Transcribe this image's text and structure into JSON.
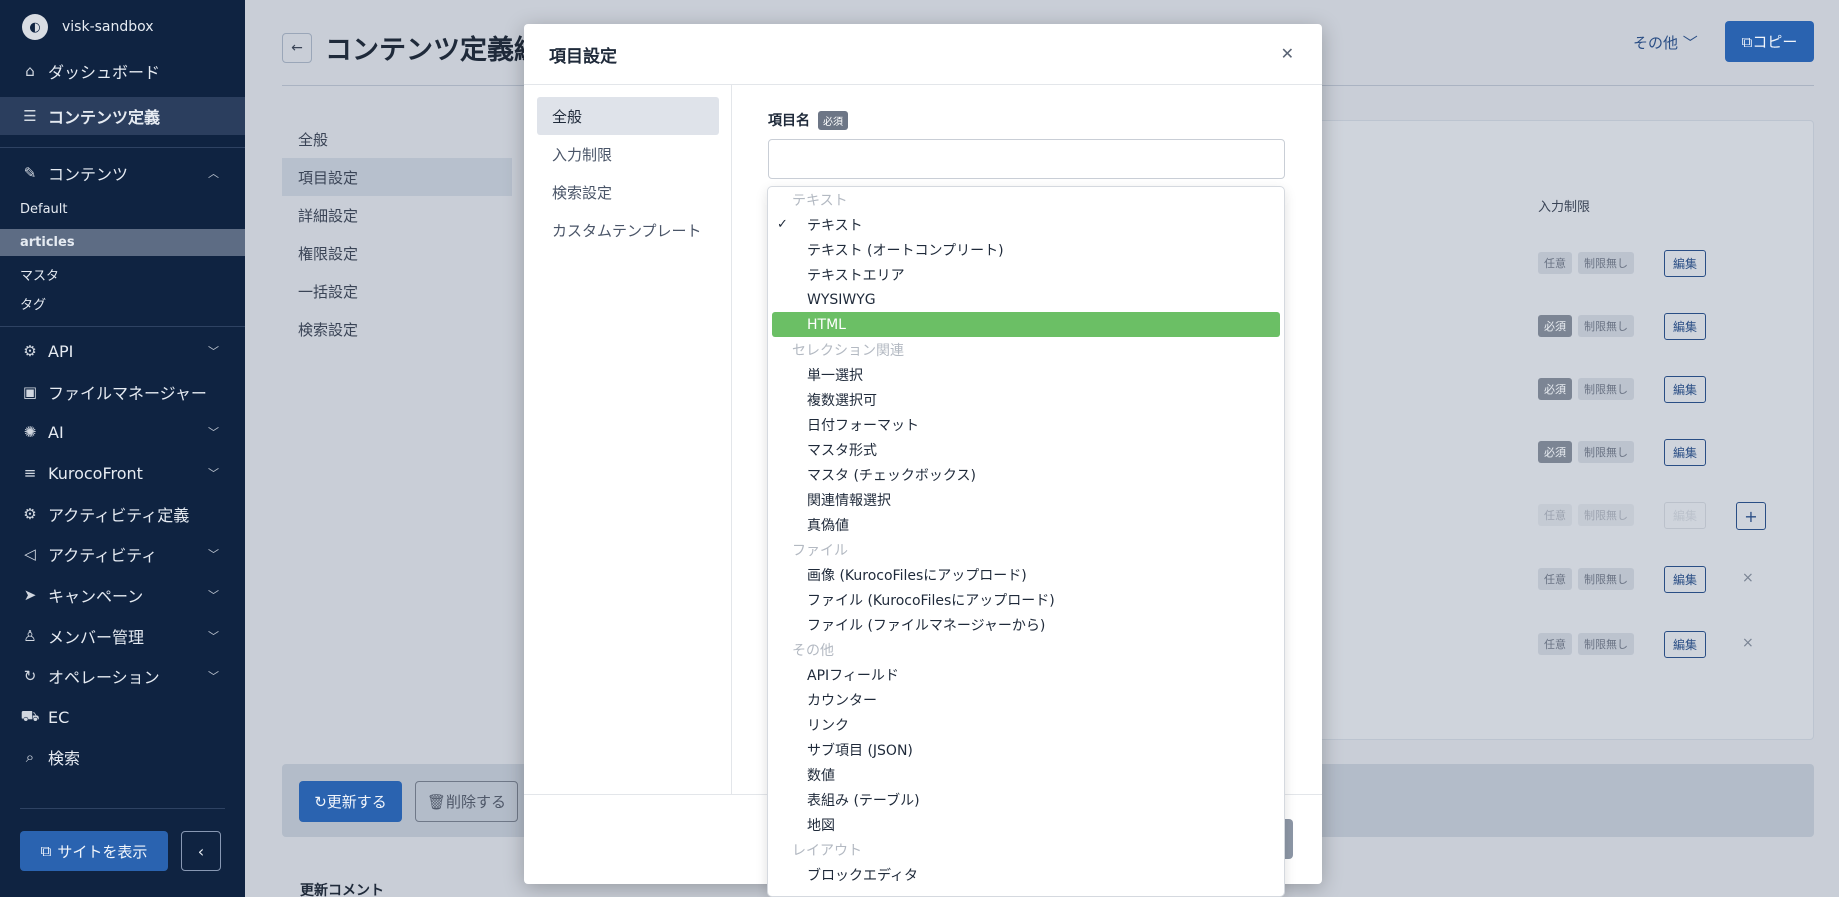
{
  "sidebar": {
    "site_name": "visk-sandbox",
    "items": [
      {
        "label": "ダッシュボード",
        "icon": "home-icon"
      },
      {
        "label": "コンテンツ定義",
        "icon": "database-icon"
      },
      {
        "label": "コンテンツ",
        "icon": "edit-icon"
      },
      {
        "label": "API",
        "icon": "gear-icon"
      },
      {
        "label": "ファイルマネージャー",
        "icon": "image-icon"
      },
      {
        "label": "AI",
        "icon": "ai-icon"
      },
      {
        "label": "KurocoFront",
        "icon": "server-icon"
      },
      {
        "label": "アクティビティ定義",
        "icon": "gear-icon"
      },
      {
        "label": "アクティビティ",
        "icon": "bullhorn-icon"
      },
      {
        "label": "キャンペーン",
        "icon": "send-icon"
      },
      {
        "label": "メンバー管理",
        "icon": "user-icon"
      },
      {
        "label": "オペレーション",
        "icon": "refresh-icon"
      },
      {
        "label": "EC",
        "icon": "cart-icon"
      },
      {
        "label": "検索",
        "icon": "search-icon"
      }
    ],
    "content_sub": [
      "Default",
      "articles",
      "マスタ",
      "タグ"
    ],
    "site_button": "サイトを表示",
    "collapse_icon": "chevron-left-icon"
  },
  "page": {
    "title": "コンテンツ定義編",
    "more_label": "その他",
    "copy_label": "コピー",
    "tabs": [
      "全般",
      "項目設定",
      "詳細設定",
      "権限設定",
      "一括設定",
      "検索設定"
    ],
    "column_header": "入力制限",
    "rows": [
      {
        "req": "任意",
        "limit": "制限無し",
        "edit": "編集"
      },
      {
        "req": "必須",
        "limit": "制限無し",
        "edit": "編集"
      },
      {
        "req": "必須",
        "limit": "制限無し",
        "edit": "編集"
      },
      {
        "req": "必須",
        "limit": "制限無し",
        "edit": "編集"
      },
      {
        "req": "任意",
        "limit": "制限無し",
        "edit": "編集"
      },
      {
        "req": "任意",
        "limit": "制限無し",
        "edit": "編集"
      },
      {
        "req": "任意",
        "limit": "制限無し",
        "edit": "編集"
      }
    ],
    "update_label": "更新する",
    "delete_label": "削除する",
    "comment_label": "更新コメント"
  },
  "modal": {
    "title": "項目設定",
    "nav": [
      "全般",
      "入力制限",
      "検索設定",
      "カスタムテンプレート"
    ],
    "field_label": "項目名",
    "required_badge": "必須",
    "name_value": ""
  },
  "dropdown": {
    "groups": [
      {
        "name": "テキスト",
        "options": [
          "テキスト",
          "テキスト (オートコンプリート)",
          "テキストエリア",
          "WYSIWYG",
          "HTML"
        ]
      },
      {
        "name": "セレクション関連",
        "options": [
          "単一選択",
          "複数選択可",
          "日付フォーマット",
          "マスタ形式",
          "マスタ (チェックボックス)",
          "関連情報選択",
          "真偽値"
        ]
      },
      {
        "name": "ファイル",
        "options": [
          "画像 (KurocoFilesにアップロード)",
          "ファイル (KurocoFilesにアップロード)",
          "ファイル (ファイルマネージャーから)"
        ]
      },
      {
        "name": "その他",
        "options": [
          "APIフィールド",
          "カウンター",
          "リンク",
          "サブ項目 (JSON)",
          "数値",
          "表組み (テーブル)",
          "地図"
        ]
      },
      {
        "name": "レイアウト",
        "options": [
          "ブロックエディタ"
        ]
      }
    ],
    "selected": "テキスト",
    "highlighted": "HTML",
    "highlight_color": "#6bbf65"
  }
}
